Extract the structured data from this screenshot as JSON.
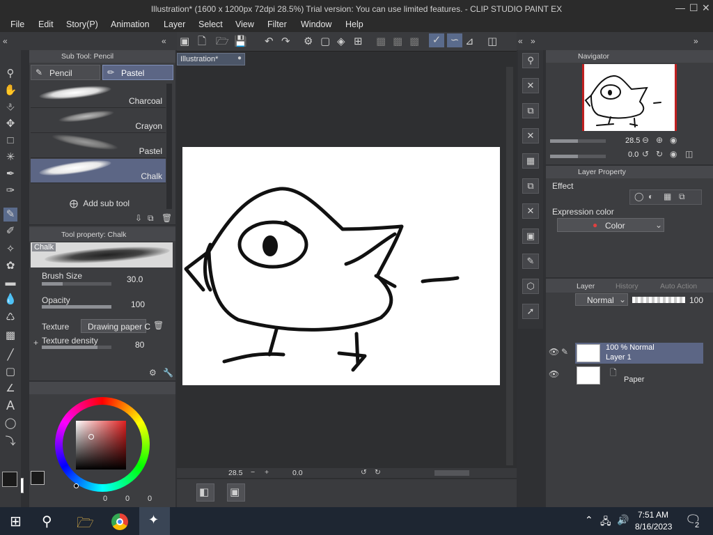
{
  "window": {
    "title": "Illustration* (1600 x 1200px 72dpi 28.5%)  Trial version: You can use limited features. - CLIP STUDIO PAINT EX"
  },
  "menu": [
    "File",
    "Edit",
    "Story(P)",
    "Animation",
    "Layer",
    "Select",
    "View",
    "Filter",
    "Window",
    "Help"
  ],
  "subtool": {
    "header": "Sub Tool: Pencil",
    "tabs": [
      "Pencil",
      "Pastel"
    ],
    "brushes": [
      {
        "label": "Charcoal",
        "selected": false
      },
      {
        "label": "Crayon",
        "selected": false
      },
      {
        "label": "Pastel",
        "selected": false
      },
      {
        "label": "Chalk",
        "selected": true
      }
    ],
    "add_label": "Add sub tool"
  },
  "tool_property": {
    "header": "Tool property: Chalk",
    "preview_label": "Chalk",
    "brush_size": {
      "label": "Brush Size",
      "value": "30.0",
      "level": 0.3
    },
    "opacity": {
      "label": "Opacity",
      "value": "100",
      "level": 1.0
    },
    "texture": {
      "label": "Texture",
      "value": "Drawing paper C"
    },
    "texture_density": {
      "label": "Texture density",
      "value": "80",
      "level": 0.8
    }
  },
  "color": {
    "main_color": "#1a1a1a",
    "sub_color": "#ffffff",
    "readouts": [
      "0",
      "0",
      "0"
    ]
  },
  "canvas": {
    "tab_label": "Illustration*",
    "zoom": "28.5",
    "angle": "0.0"
  },
  "navigator": {
    "header": "Navigator",
    "zoom": "28.5",
    "angle": "0.0"
  },
  "layer_property": {
    "header": "Layer Property",
    "effect_label": "Effect",
    "expression_label": "Expression color",
    "expression_value": "Color"
  },
  "layers": {
    "tabs": [
      "Layer",
      "History",
      "Auto Action"
    ],
    "blend_mode": "Normal",
    "opacity": "100",
    "items": [
      {
        "line1": "100 % Normal",
        "line2": "Layer 1",
        "selected": true
      },
      {
        "line1": "",
        "line2": "Paper",
        "selected": false
      }
    ]
  },
  "taskbar": {
    "time": "7:51 AM",
    "date": "8/16/2023",
    "notifications": "2"
  }
}
